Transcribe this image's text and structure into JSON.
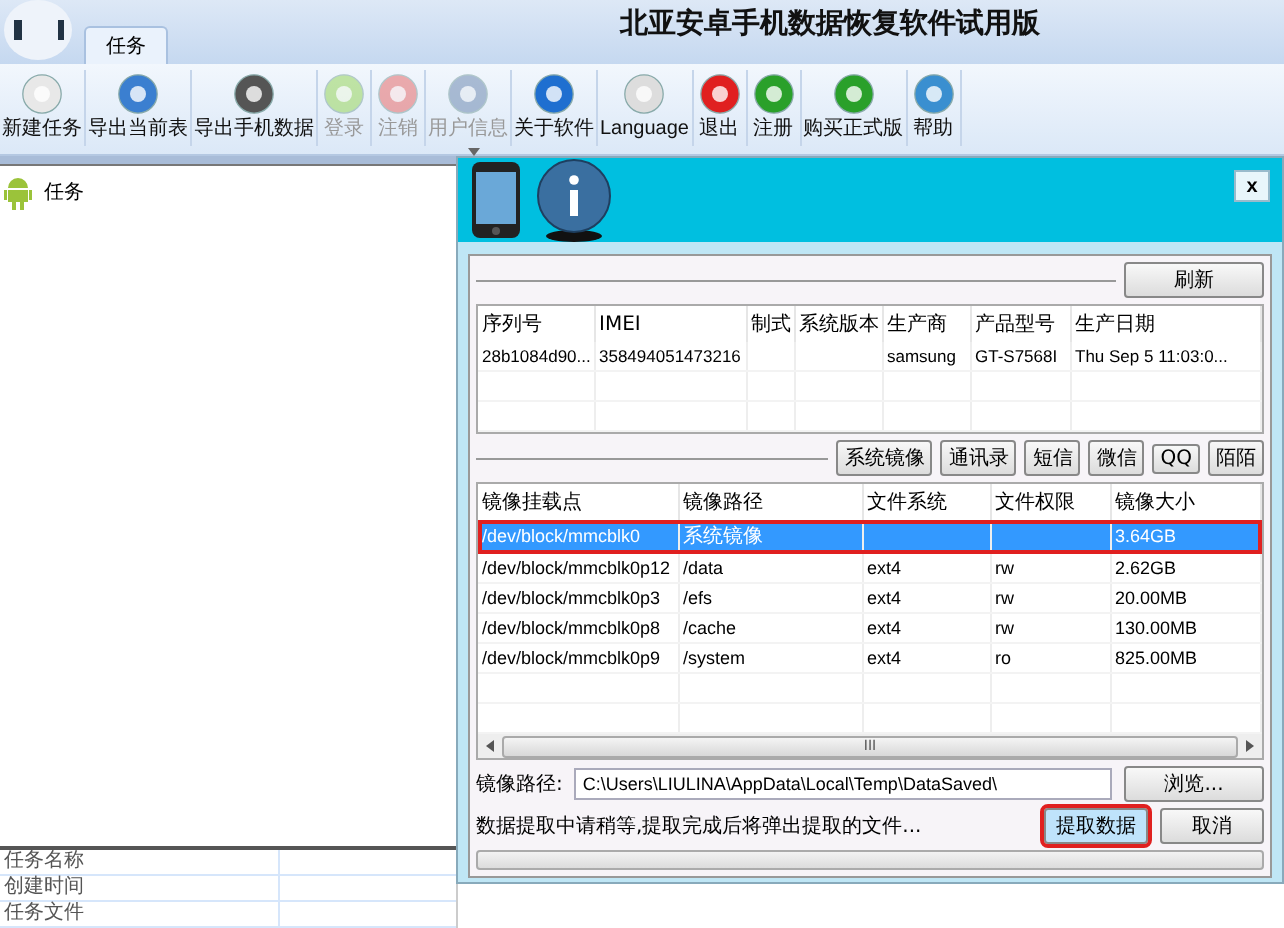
{
  "app_title": "北亚安卓手机数据恢复软件试用版",
  "tabs": [
    {
      "label": "任务",
      "selected": true
    }
  ],
  "toolbar": [
    {
      "label": "新建任务",
      "disabled": false,
      "dropdown": false
    },
    {
      "label": "导出当前表",
      "disabled": false,
      "dropdown": false
    },
    {
      "label": "导出手机数据",
      "disabled": false,
      "dropdown": false
    },
    {
      "label": "登录",
      "disabled": true,
      "dropdown": false
    },
    {
      "label": "注销",
      "disabled": true,
      "dropdown": false
    },
    {
      "label": "用户信息",
      "disabled": true,
      "dropdown": true
    },
    {
      "label": "关于软件",
      "disabled": false,
      "dropdown": false
    },
    {
      "label": "Language",
      "disabled": false,
      "dropdown": false
    },
    {
      "label": "退出",
      "disabled": false,
      "dropdown": false
    },
    {
      "label": "注册",
      "disabled": false,
      "dropdown": false
    },
    {
      "label": "购买正式版",
      "disabled": false,
      "dropdown": false
    },
    {
      "label": "帮助",
      "disabled": false,
      "dropdown": false
    }
  ],
  "task_tree": [
    {
      "label": "任务"
    }
  ],
  "properties": [
    {
      "name": "任务名称"
    },
    {
      "name": "创建时间"
    },
    {
      "name": "任务文件"
    }
  ],
  "dialog": {
    "close": "x",
    "refresh_button": "刷新",
    "device_table": {
      "columns": [
        "序列号",
        "IMEI",
        "制式",
        "系统版本",
        "生产商",
        "产品型号",
        "生产日期"
      ],
      "rows": [
        [
          "28b1084d90...",
          "358494051473216",
          "",
          "",
          "samsung",
          "GT-S7568I",
          "Thu Sep  5 11:03:0..."
        ]
      ]
    },
    "app_buttons": [
      "系统镜像",
      "通讯录",
      "短信",
      "微信",
      "QQ",
      "陌陌"
    ],
    "partition_table": {
      "columns": [
        "镜像挂载点",
        "镜像路径",
        "文件系统",
        "文件权限",
        "镜像大小"
      ],
      "rows": [
        {
          "cells": [
            "/dev/block/mmcblk0",
            "系统镜像",
            "",
            "",
            "3.64GB"
          ],
          "selected": true
        },
        {
          "cells": [
            "/dev/block/mmcblk0p12",
            "/data",
            "ext4",
            "rw",
            "2.62GB"
          ],
          "selected": false
        },
        {
          "cells": [
            "/dev/block/mmcblk0p3",
            "/efs",
            "ext4",
            "rw",
            "20.00MB"
          ],
          "selected": false
        },
        {
          "cells": [
            "/dev/block/mmcblk0p8",
            "/cache",
            "ext4",
            "rw",
            "130.00MB"
          ],
          "selected": false
        },
        {
          "cells": [
            "/dev/block/mmcblk0p9",
            "/system",
            "ext4",
            "ro",
            "825.00MB"
          ],
          "selected": false
        }
      ]
    },
    "scroll_grip": "III",
    "path_label": "镜像路径:",
    "path_value": "C:\\Users\\LIULINA\\AppData\\Local\\Temp\\DataSaved\\",
    "browse_button": "浏览...",
    "status_text": "数据提取中请稍等,提取完成后将弹出提取的文件...",
    "extract_button": {
      "label": "提取数据",
      "highlighted": true
    },
    "cancel_button": "取消",
    "progress": {
      "level": 0
    }
  }
}
